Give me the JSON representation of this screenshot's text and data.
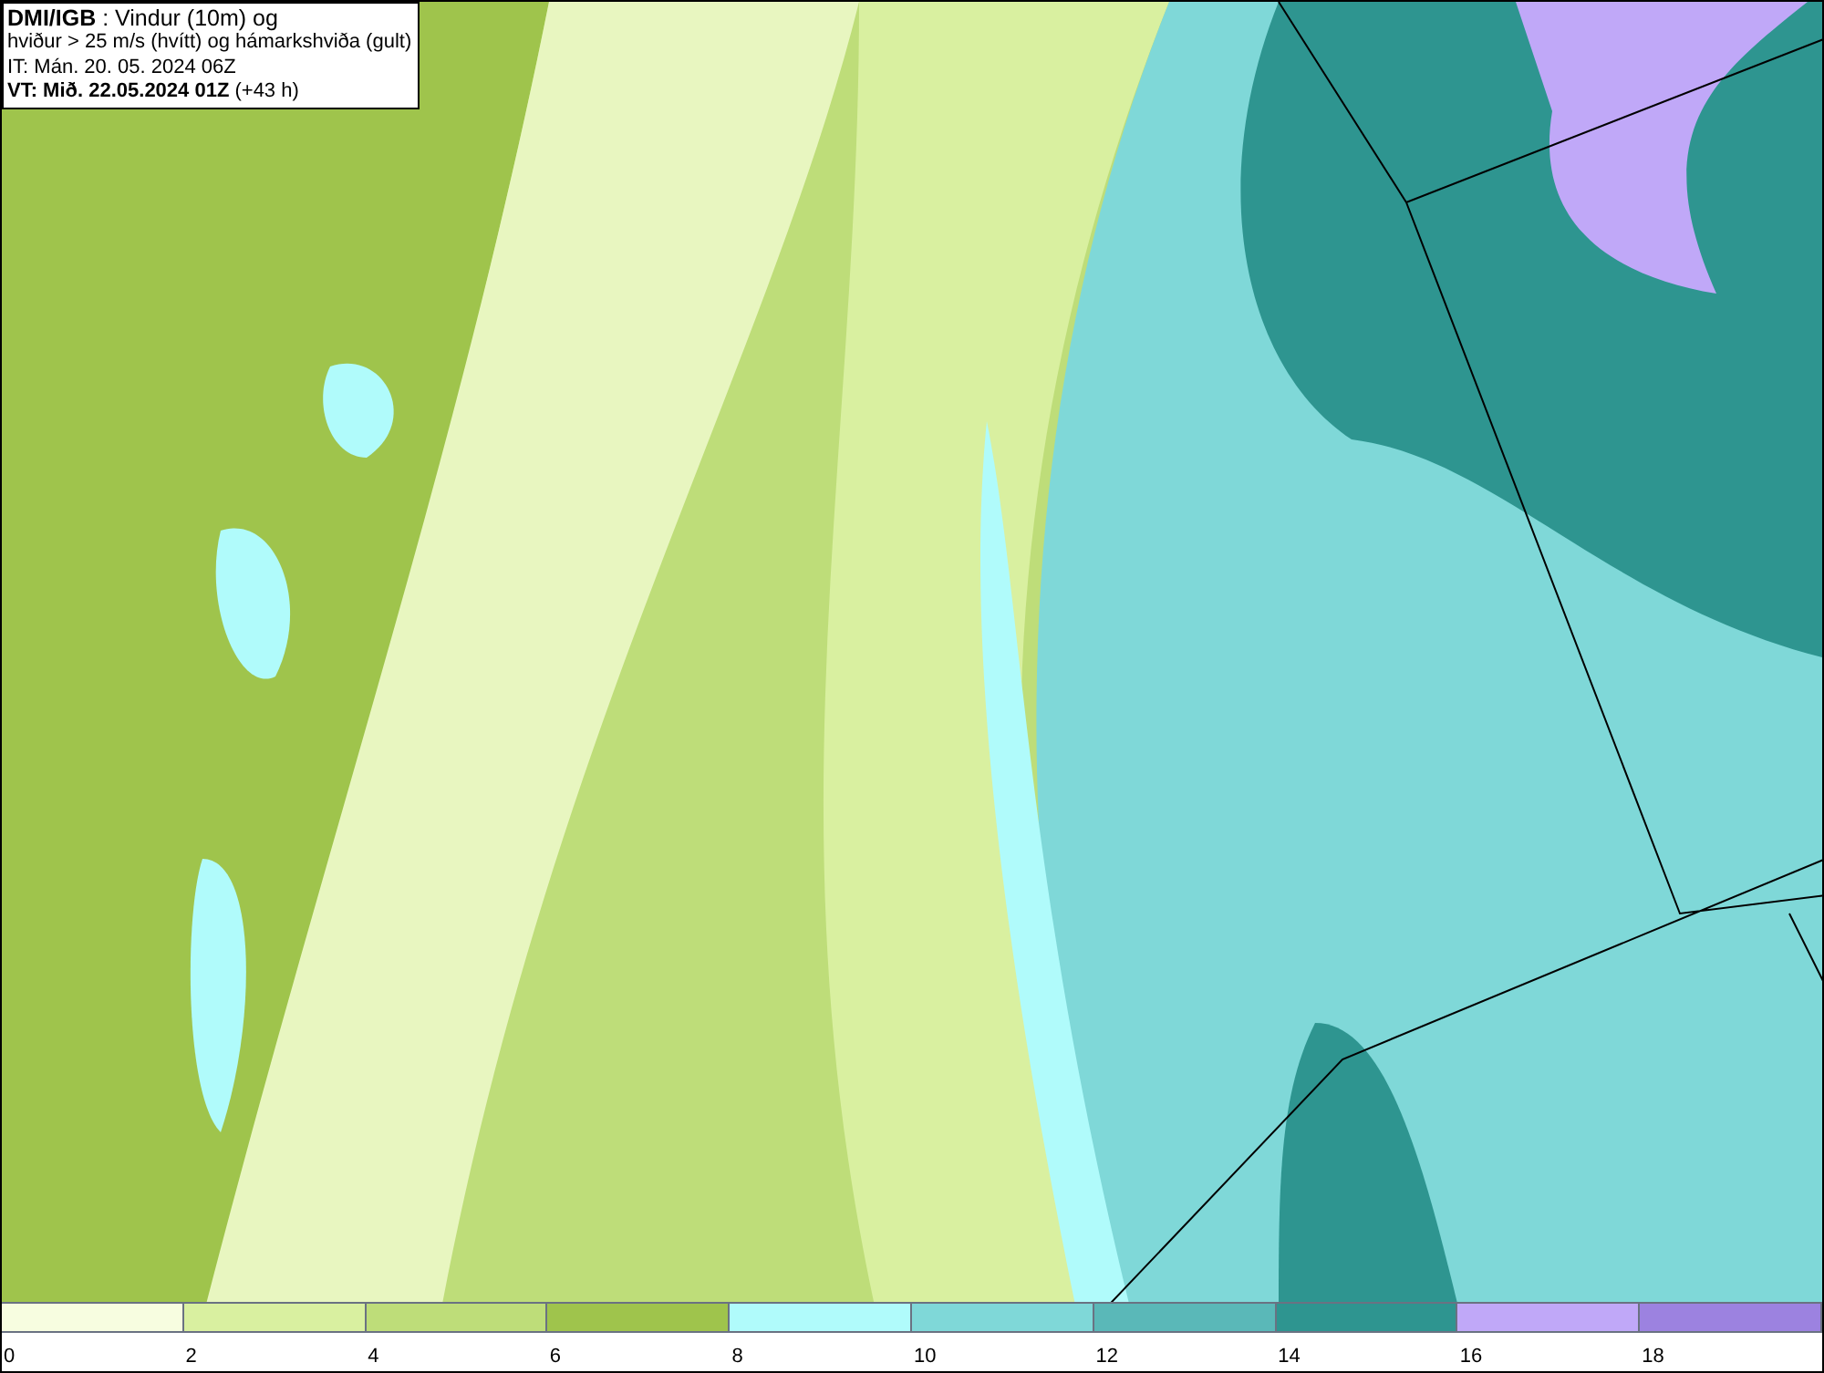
{
  "header": {
    "lines": [
      "**DMI/IGB** : Vindur (10m) og",
      "hviður > 25 m/s (hvítt) og hámarkshviða (gult)",
      "IT: Mán. 20. 05. 2024 06Z",
      "**VT: Mið. 22.05.2024 01Z** (+43 h)"
    ]
  },
  "legend": {
    "bins": [
      {
        "color": "#f7fde0"
      },
      {
        "color": "#d9f0a0"
      },
      {
        "color": "#bedd79"
      },
      {
        "color": "#9fc44c"
      },
      {
        "color": "#b0fbfb"
      },
      {
        "color": "#7fd8d8"
      },
      {
        "color": "#5ab8b8"
      },
      {
        "color": "#2e9590"
      },
      {
        "color": "#c0a8f8"
      },
      {
        "color": "#9c82e0"
      }
    ],
    "ticks": [
      "0",
      "2",
      "4",
      "6",
      "8",
      "10",
      "12",
      "14",
      "16",
      "18"
    ]
  }
}
